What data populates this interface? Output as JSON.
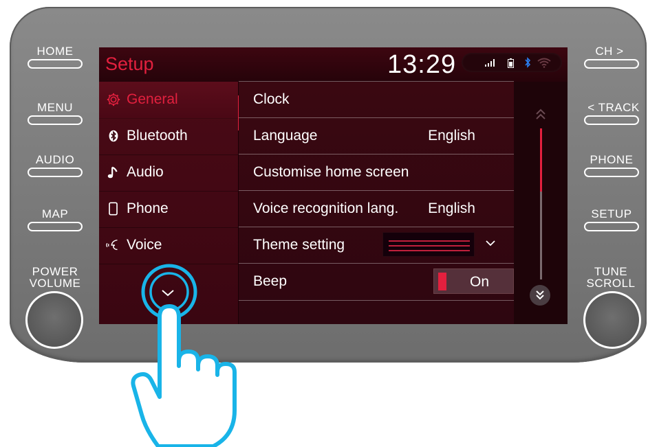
{
  "hardware": {
    "left_buttons": [
      "HOME",
      "MENU",
      "AUDIO",
      "MAP"
    ],
    "right_buttons": [
      "CH >",
      "< TRACK",
      "PHONE",
      "SETUP"
    ],
    "left_knob_line1": "POWER",
    "left_knob_line2": "VOLUME",
    "right_knob_line1": "TUNE",
    "right_knob_line2": "SCROLL"
  },
  "screen": {
    "title": "Setup",
    "clock": "13:29",
    "status_icons": [
      "signal-icon",
      "battery-icon",
      "bluetooth-icon",
      "wifi-icon"
    ]
  },
  "sidebar": {
    "items": [
      {
        "label": "General",
        "icon": "gear-icon",
        "active": true
      },
      {
        "label": "Bluetooth",
        "icon": "bluetooth-icon",
        "active": false
      },
      {
        "label": "Audio",
        "icon": "music-note-icon",
        "active": false
      },
      {
        "label": "Phone",
        "icon": "phone-icon",
        "active": false
      },
      {
        "label": "Voice",
        "icon": "voice-icon",
        "active": false
      }
    ],
    "more_icon": "chevron-down-icon"
  },
  "settings": {
    "rows": [
      {
        "label": "Clock",
        "value": ""
      },
      {
        "label": "Language",
        "value": "English"
      },
      {
        "label": "Customise home screen",
        "value": ""
      },
      {
        "label": "Voice recognition lang.",
        "value": "English"
      },
      {
        "label": "Theme setting",
        "value": ""
      },
      {
        "label": "Beep",
        "value": "On"
      }
    ]
  },
  "colors": {
    "accent": "#e2203e",
    "touch_highlight": "#19b4e8",
    "bezel": "#7a7a7a"
  }
}
